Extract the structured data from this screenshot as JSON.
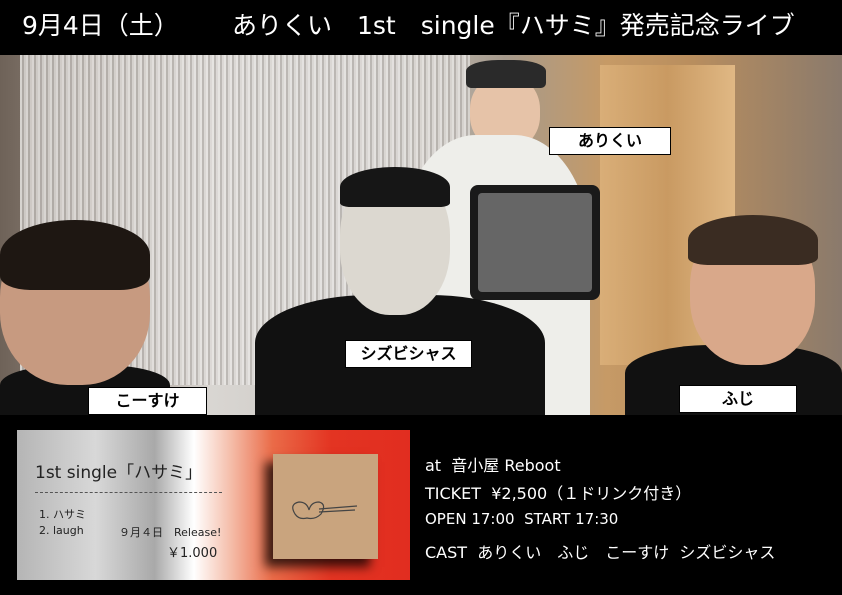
{
  "header": {
    "date": "9月4日（土）",
    "event": "ありくい　1st　single『ハサミ』発売記念ライブ"
  },
  "photo": {
    "labels": {
      "arikui": "ありくい",
      "shizubishasu": "シズビシャス",
      "kosuke": "こーすけ",
      "fuji": "ふじ"
    }
  },
  "single": {
    "title": "1st single「ハサミ」",
    "tracks": [
      "1. ハサミ",
      "2. laugh"
    ],
    "release": "９月４日　Release!",
    "price": "￥1.000",
    "cover_icon": "scissors-icon"
  },
  "info": {
    "venue": "at  音小屋 Reboot",
    "ticket": "TICKET  ¥2,500（１ドリンク付き）",
    "times": "OPEN 17:00  START 17:30",
    "cast": "CAST  ありくい　ふじ　こーすけ  シズビシャス"
  },
  "colors": {
    "accent": "#e12d20",
    "background": "#000000"
  }
}
